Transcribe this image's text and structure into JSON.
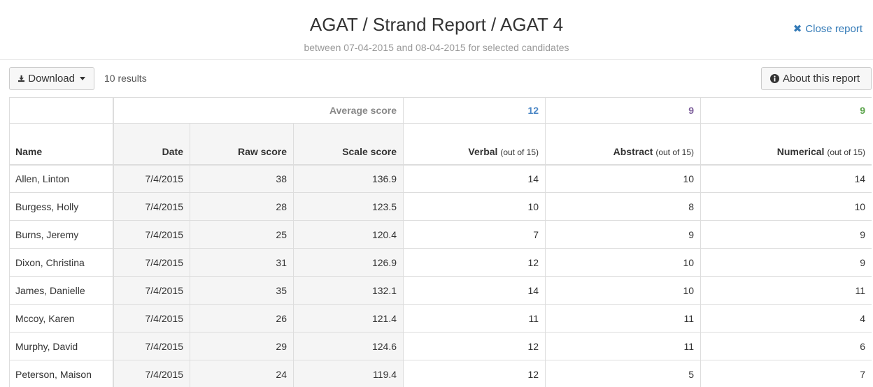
{
  "header": {
    "title": "AGAT / Strand Report / AGAT 4",
    "subtitle": "between 07-04-2015 and 08-04-2015 for selected candidates",
    "close_label": "Close report"
  },
  "toolbar": {
    "download_label": "Download",
    "results_label": "10 results",
    "about_label": "About this report"
  },
  "table": {
    "average_label": "Average score",
    "averages": {
      "verbal": "12",
      "abstract": "9",
      "numerical": "9"
    },
    "columns": {
      "name": "Name",
      "date": "Date",
      "raw": "Raw score",
      "scale": "Scale score",
      "verbal": "Verbal",
      "abstract": "Abstract",
      "numerical": "Numerical",
      "out_of": "(out of 15)"
    },
    "rows": [
      {
        "name": "Allen, Linton",
        "date": "7/4/2015",
        "raw": "38",
        "scale": "136.9",
        "verbal": "14",
        "abstract": "10",
        "numerical": "14"
      },
      {
        "name": "Burgess, Holly",
        "date": "7/4/2015",
        "raw": "28",
        "scale": "123.5",
        "verbal": "10",
        "abstract": "8",
        "numerical": "10"
      },
      {
        "name": "Burns, Jeremy",
        "date": "7/4/2015",
        "raw": "25",
        "scale": "120.4",
        "verbal": "7",
        "abstract": "9",
        "numerical": "9"
      },
      {
        "name": "Dixon, Christina",
        "date": "7/4/2015",
        "raw": "31",
        "scale": "126.9",
        "verbal": "12",
        "abstract": "10",
        "numerical": "9"
      },
      {
        "name": "James, Danielle",
        "date": "7/4/2015",
        "raw": "35",
        "scale": "132.1",
        "verbal": "14",
        "abstract": "10",
        "numerical": "11"
      },
      {
        "name": "Mccoy, Karen",
        "date": "7/4/2015",
        "raw": "26",
        "scale": "121.4",
        "verbal": "11",
        "abstract": "11",
        "numerical": "4"
      },
      {
        "name": "Murphy, David",
        "date": "7/4/2015",
        "raw": "29",
        "scale": "124.6",
        "verbal": "12",
        "abstract": "11",
        "numerical": "6"
      },
      {
        "name": "Peterson, Maison",
        "date": "7/4/2015",
        "raw": "24",
        "scale": "119.4",
        "verbal": "12",
        "abstract": "5",
        "numerical": "7"
      }
    ]
  },
  "colors": {
    "verbal": "#4a86c5",
    "abstract": "#7d5f9b",
    "numerical": "#5aa34a",
    "link": "#337ab7"
  }
}
